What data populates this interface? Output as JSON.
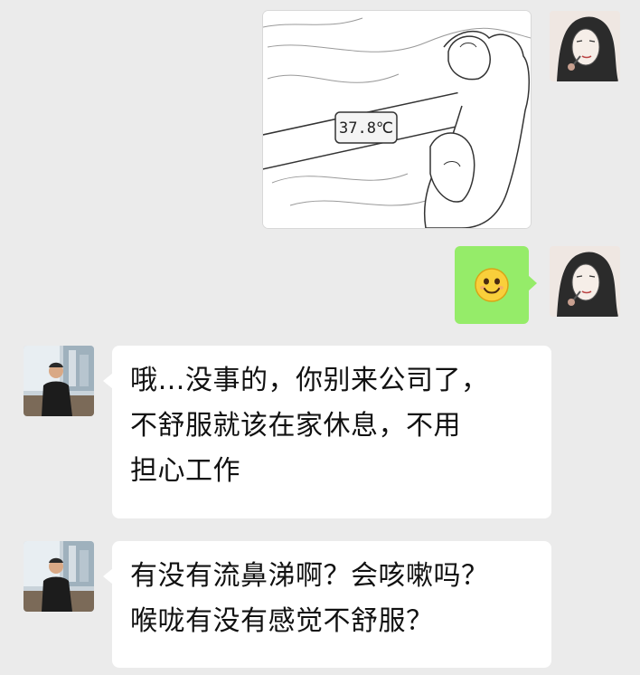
{
  "chat": {
    "messages": [
      {
        "direction": "outgoing",
        "type": "image",
        "image": {
          "subject": "thermometer",
          "thermometer_reading": "37.8℃"
        },
        "avatar": "user-avatar-woman-sketch"
      },
      {
        "direction": "outgoing",
        "type": "emoji",
        "emoji": "smiley-face-icon",
        "avatar": "user-avatar-woman-sketch"
      },
      {
        "direction": "incoming",
        "type": "text",
        "lines": [
          "哦…没事的，你别来公司了，",
          "不舒服就该在家休息，不用",
          "担心工作"
        ],
        "avatar": "contact-avatar-man-photo"
      },
      {
        "direction": "incoming",
        "type": "text",
        "lines": [
          "有没有流鼻涕啊？会咳嗽吗？",
          "喉咙有没有感觉不舒服？"
        ],
        "avatar": "contact-avatar-man-photo"
      }
    ]
  },
  "colors": {
    "background": "#ebebeb",
    "outgoing_bubble": "#95ec69",
    "incoming_bubble": "#ffffff",
    "text": "#111111"
  }
}
